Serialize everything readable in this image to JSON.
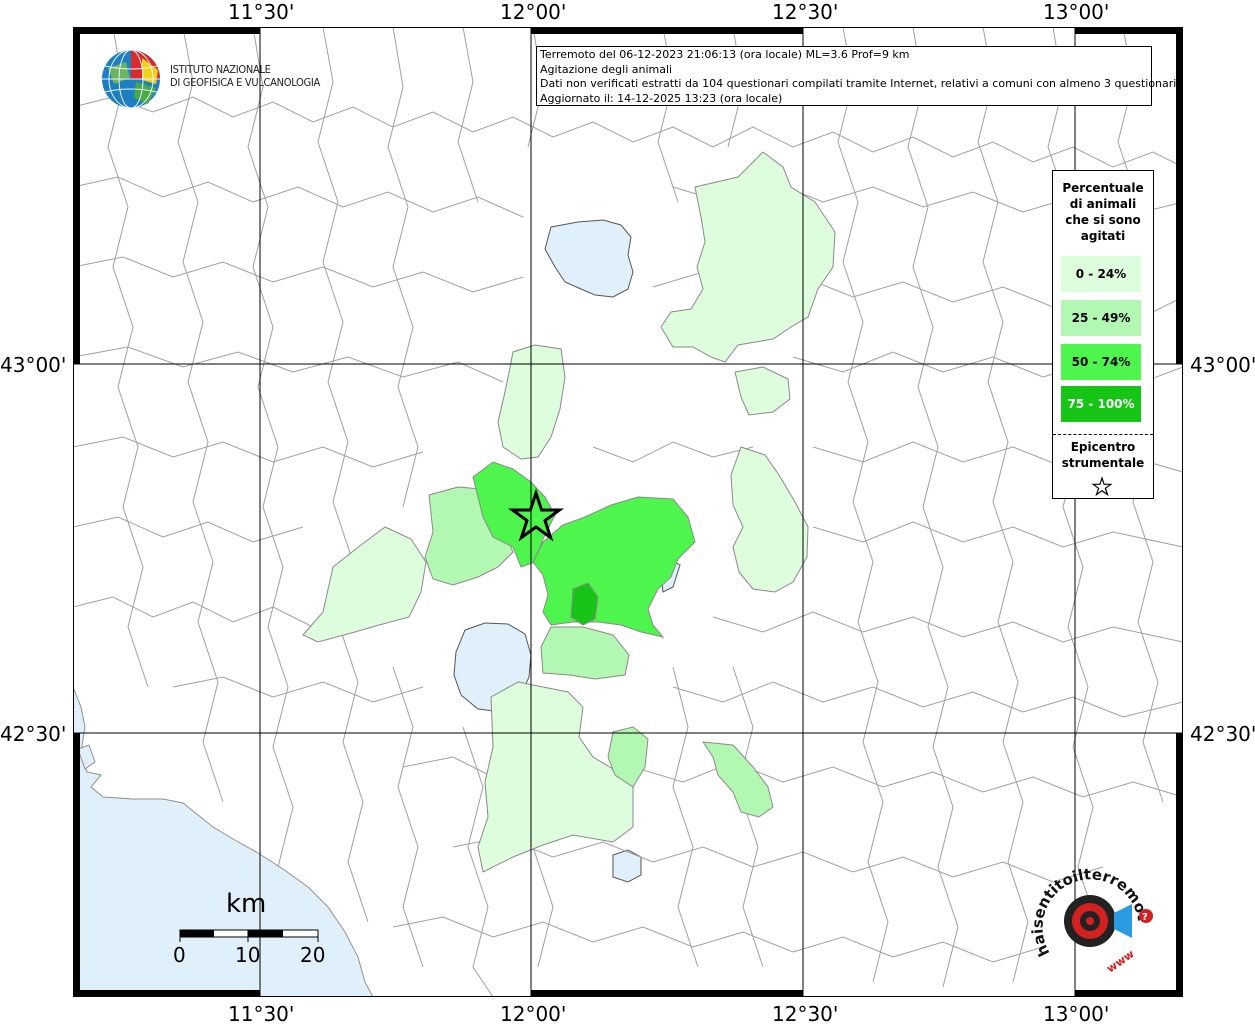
{
  "colors": {
    "sea": "#dff0fb",
    "lake": "#dff0fb",
    "class_0_24": "#ddfddd",
    "class_25_49": "#b2f8b2",
    "class_50_74": "#4df54d",
    "class_75_100": "#16c516",
    "boundary": "#a0a0a0",
    "grid": "#000000"
  },
  "axes": {
    "lon_labels": [
      "11°30'",
      "12°00'",
      "12°30'",
      "13°00'"
    ],
    "lat_labels": [
      "43°00'",
      "42°30'"
    ]
  },
  "info": {
    "line1": "Terremoto del 06-12-2023 21:06:13 (ora locale) ML=3.6 Prof=9 km",
    "line2": "Agitazione degli animali",
    "line3": "Dati non verificati estratti da 104 questionari compilati tramite Internet, relativi a comuni con almeno 3 questionari.",
    "line4": "Aggiornato il: 14-12-2025 13:23 (ora locale)"
  },
  "legend": {
    "title_line1": "Percentuale",
    "title_line2": "di animali",
    "title_line3": "che si sono",
    "title_line4": "agitati",
    "classes": [
      {
        "label": "0 - 24%",
        "color": "#ddfddd"
      },
      {
        "label": "25 - 49%",
        "color": "#b2f8b2"
      },
      {
        "label": "50 - 74%",
        "color": "#4df54d"
      },
      {
        "label": "75 - 100%",
        "color": "#16c516"
      }
    ],
    "epicenter_line1": "Epicentro",
    "epicenter_line2": "strumentale"
  },
  "logo": {
    "line1": "ISTITUTO NAZIONALE",
    "line2": "DI GEOFISICA E VULCANOLOGIA"
  },
  "scale": {
    "unit": "km",
    "ticks": [
      "0",
      "10",
      "20"
    ]
  },
  "hst_logo": {
    "text": "www.haisentitoilterremoto.it",
    "icon": "haisentito-logo"
  }
}
